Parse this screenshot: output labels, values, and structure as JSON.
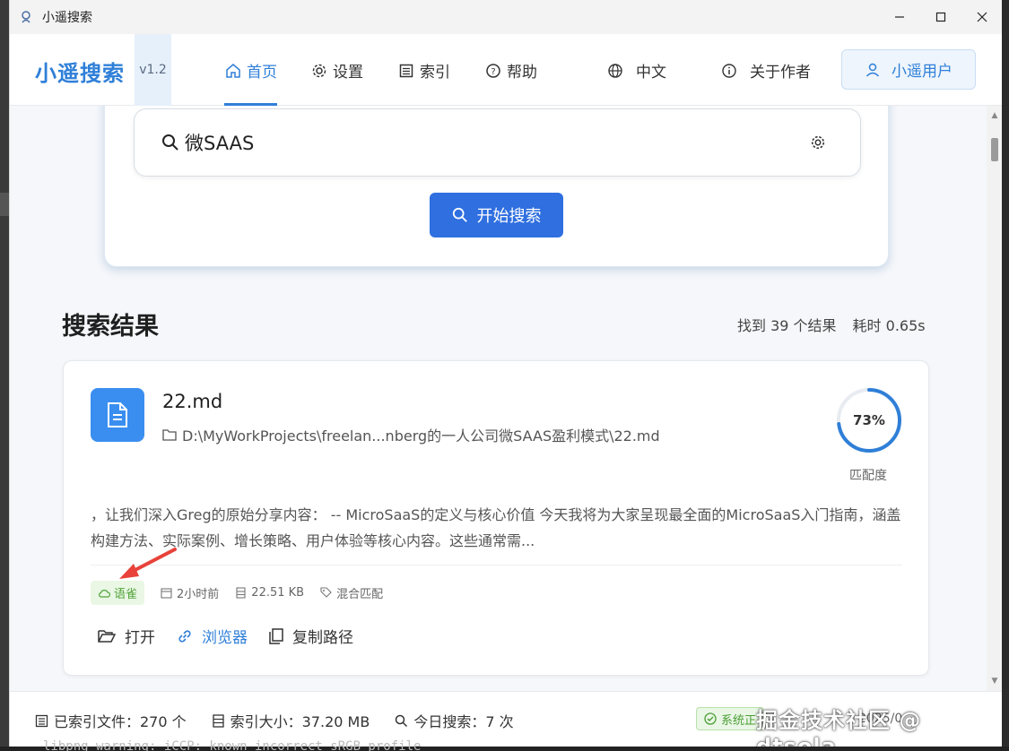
{
  "window": {
    "title": "小遥搜索"
  },
  "brand": {
    "name": "小遥搜索",
    "version": "v1.2"
  },
  "nav": {
    "home": "首页",
    "settings": "设置",
    "index": "索引",
    "help": "帮助",
    "language": "中文",
    "about": "关于作者",
    "user": "小遥用户"
  },
  "search": {
    "query": "微SAAS",
    "button": "开始搜索"
  },
  "results": {
    "title": "搜索结果",
    "count_text": "找到 39 个结果",
    "time_text": "耗时 0.65s",
    "items": [
      {
        "name": "22.md",
        "path": "D:\\MyWorkProjects\\freelan...nberg的一人公司微SAAS盈利模式\\22.md",
        "match_percent": 73,
        "match_text": "73%",
        "match_label": "匹配度",
        "snippet": "，让我们深入Greg的原始分享内容： -- MicroSaaS的定义与核心价值 今天我将为大家呈现最全面的MicroSaaS入门指南，涵盖构建方法、实际案例、增长策略、用户体验等核心内容。这些通常需...",
        "source": "语雀",
        "time": "2小时前",
        "size": "22.51 KB",
        "match_type": "混合匹配",
        "actions": {
          "open": "打开",
          "browser": "浏览器",
          "copy": "复制路径"
        }
      }
    ]
  },
  "footer": {
    "indexed": "已索引文件：270 个",
    "index_size": "索引大小：37.20 MB",
    "today": "今日搜索：7 次",
    "status": "系统正",
    "tail": "2025/0"
  },
  "overlay": {
    "watermark": "掘金技术社区 @ dtsola",
    "terminal_text": "libpng warning: iCCP: known incorrect sRGB profile"
  },
  "colors": {
    "accent": "#2f7fd8",
    "button": "#2f6fe0",
    "success": "#52a43a",
    "arrow": "#e8423a"
  }
}
